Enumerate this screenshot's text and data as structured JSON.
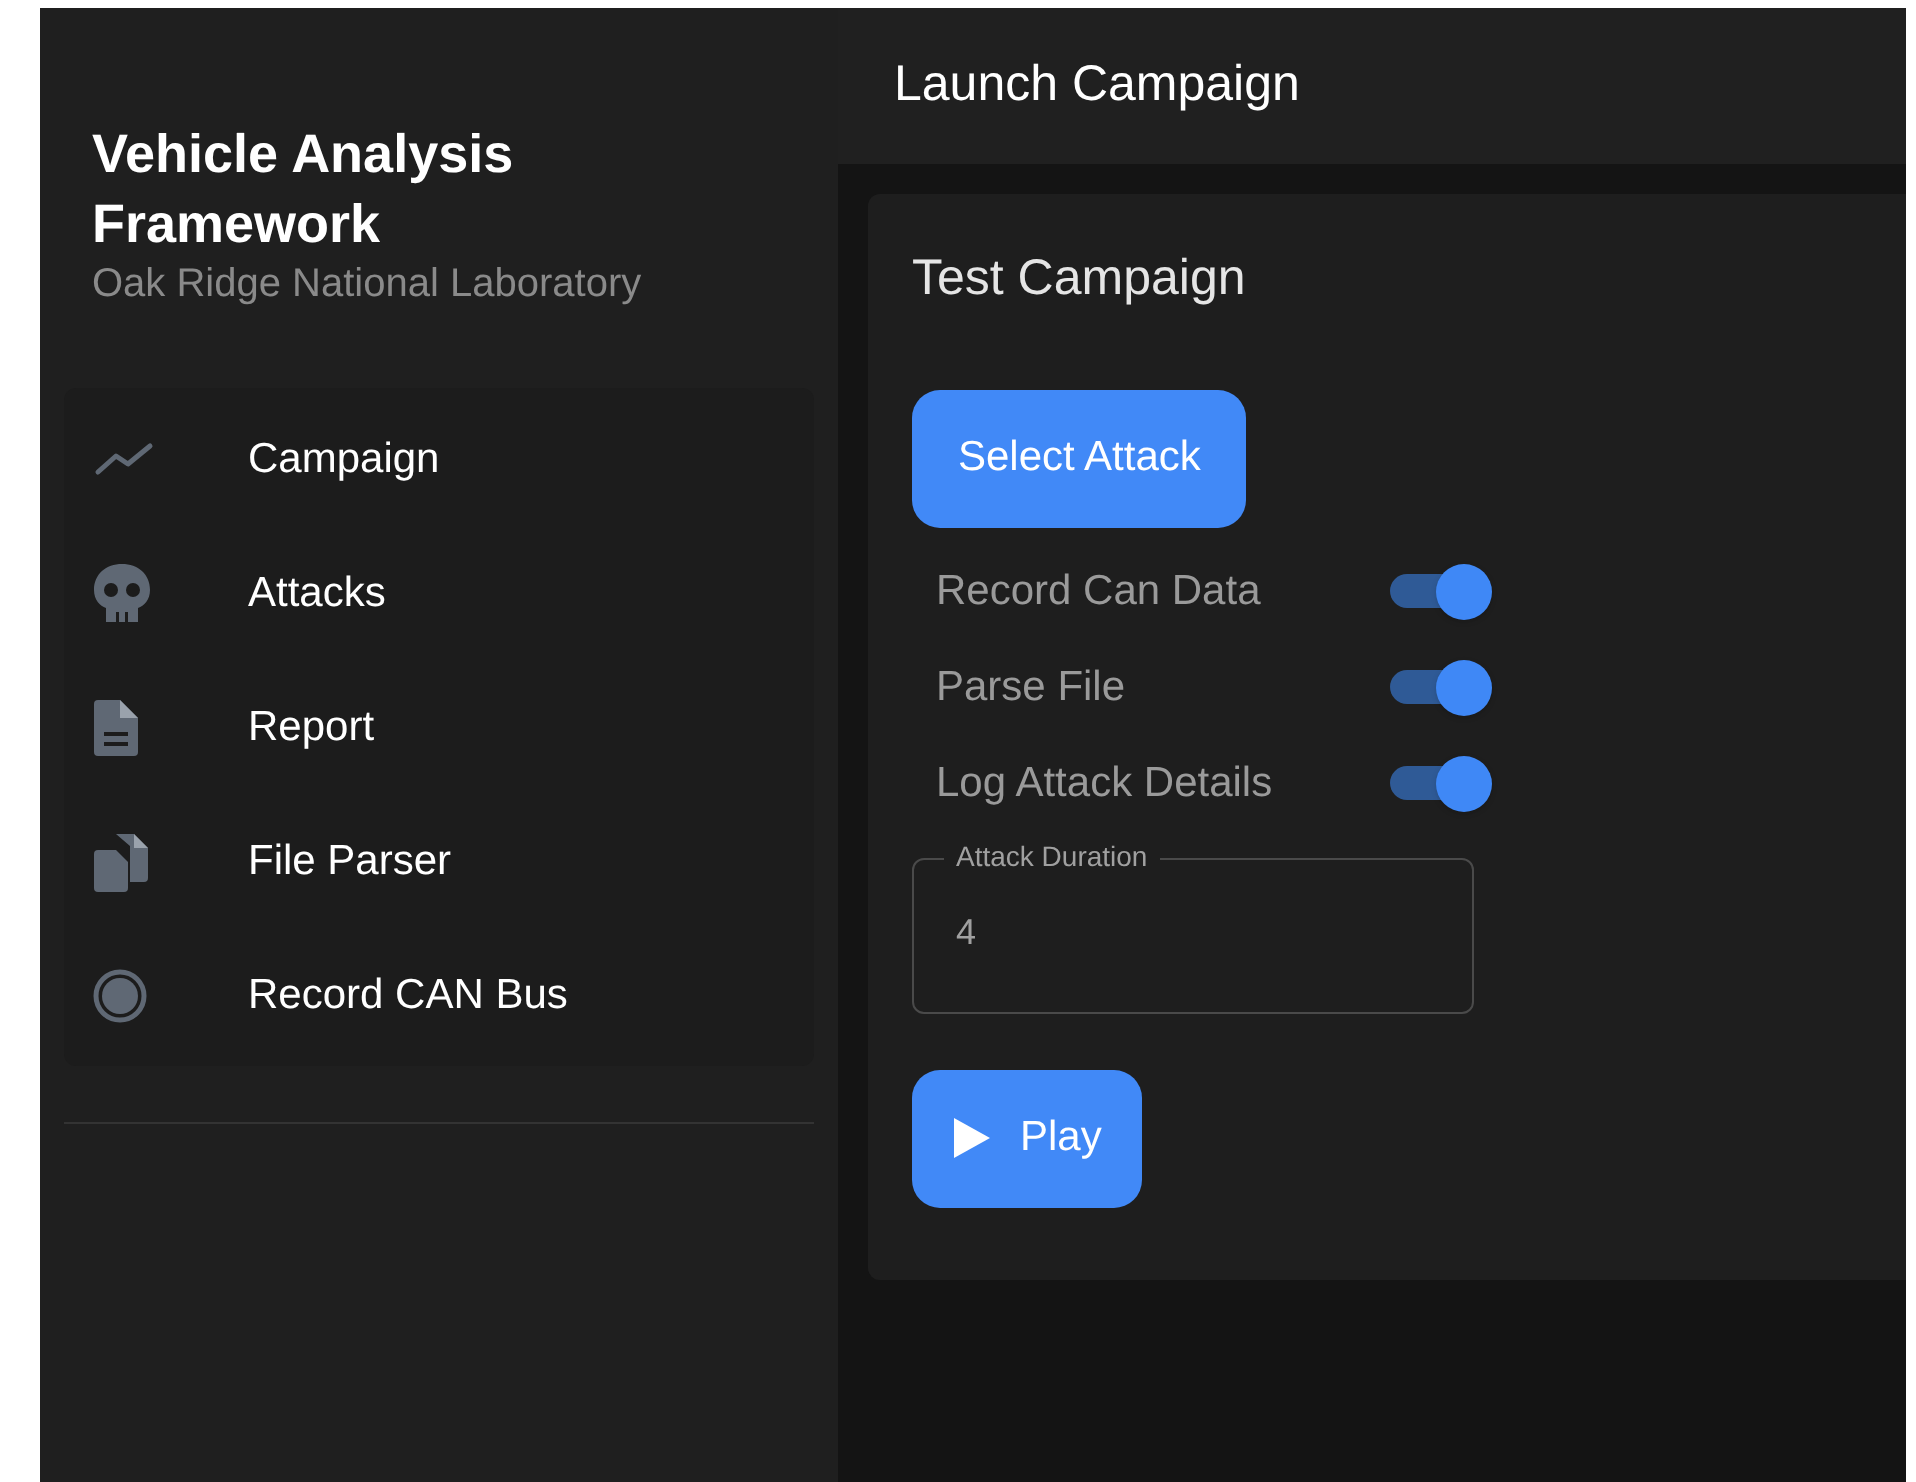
{
  "sidebar": {
    "title": "Vehicle Analysis Framework",
    "subtitle": "Oak Ridge National Laboratory",
    "items": [
      {
        "label": "Campaign",
        "kind": "chart"
      },
      {
        "label": "Attacks",
        "kind": "skull"
      },
      {
        "label": "Report",
        "kind": "document"
      },
      {
        "label": "File Parser",
        "kind": "files"
      },
      {
        "label": "Record CAN Bus",
        "kind": "record"
      }
    ]
  },
  "header": {
    "title": "Launch Campaign"
  },
  "card": {
    "title": "Test Campaign",
    "select_button": "Select Attack",
    "toggles": [
      {
        "label": "Record Can Data",
        "on": true
      },
      {
        "label": "Parse File",
        "on": true
      },
      {
        "label": "Log Attack Details",
        "on": true
      }
    ],
    "duration": {
      "label": "Attack Duration",
      "value": "4"
    },
    "play_button": "Play"
  }
}
